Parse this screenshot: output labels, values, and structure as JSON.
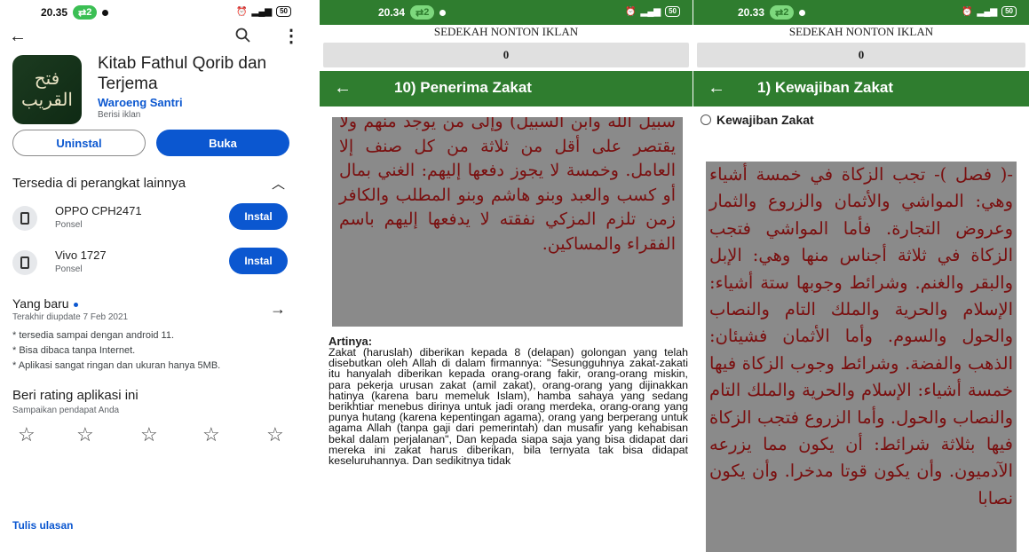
{
  "p1": {
    "status": {
      "time": "20.35",
      "badge": "2",
      "battery": "50"
    },
    "app": {
      "title": "Kitab Fathul Qorib dan Terjema",
      "developer": "Waroeng Santri",
      "ads": "Berisi iklan",
      "icon_text": "فتح القريب"
    },
    "buttons": {
      "uninstall": "Uninstal",
      "open": "Buka"
    },
    "other_devices": {
      "title": "Tersedia di perangkat lainnya",
      "devices": [
        {
          "name": "OPPO CPH2471",
          "type": "Ponsel",
          "action": "Instal"
        },
        {
          "name": "Vivo 1727",
          "type": "Ponsel",
          "action": "Instal"
        }
      ]
    },
    "whats_new": {
      "title": "Yang baru",
      "updated": "Terakhir diupdate 7 Feb 2021",
      "notes": [
        "* tersedia sampai dengan android 11.",
        "* Bisa dibaca tanpa Internet.",
        "* Aplikasi sangat ringan dan ukuran hanya 5MB."
      ]
    },
    "rating": {
      "title": "Beri rating aplikasi ini",
      "subtitle": "Sampaikan pendapat Anda"
    },
    "write_review": "Tulis ulasan"
  },
  "p2": {
    "status": {
      "time": "20.34",
      "badge": "2",
      "battery": "50"
    },
    "banner": "SEDEKAH NONTON IKLAN",
    "counter": "0",
    "title": "10) Penerima Zakat",
    "arabic": "سبيل الله وابن السبيل) وإلى من يوجد منهم ولا يقتصر على أقل من ثلاثة من كل صنف إلا العامل. وخمسة لا يجوز دفعها إليهم: الغني بمال أو كسب والعبد وبنو هاشم وبنو المطلب والكافر زمن تلزم المزكي نفقته لا يدفعها إليهم باسم الفقراء والمساكين.",
    "artinya_label": "Artinya:",
    "artinya": "Zakat (haruslah) diberikan kepada 8 (delapan) golongan yang telah disebutkan oleh Allah di dalam firmannya: \"Sesungguhnya zakat-zakati itu hanyalah diberikan kepada orang-orang fakir, orang-orang miskin, para pekerja urusan zakat (amil zakat), orang-orang yang dijinakkan hatinya (karena baru memeluk Islam), hamba sahaya yang sedang berikhtiar menebus dirinya untuk jadi orang merdeka, orang-orang yang punya hutang (karena kepentingan agama), orang yang berperang untuk agama Allah (tanpa gaji dari pemerintah) dan musafir yang kehabisan bekal dalam perjalanan\", Dan kepada siapa saja yang bisa didapat dari mereka ini zakat harus diberikan, bila ternyata tak bisa didapat keseluruhannya. Dan sedikitnya tidak"
  },
  "p3": {
    "status": {
      "time": "20.33",
      "badge": "2",
      "battery": "50"
    },
    "banner": "SEDEKAH NONTON IKLAN",
    "counter": "0",
    "title": "1) Kewajiban Zakat",
    "subtitle": "Kewajiban Zakat",
    "arabic": "-( فصل )- تجب الزكاة في خمسة أشياء وهي: المواشي والأثمان والزروع والثمار وعروض التجارة. فأما المواشي فتجب الزكاة في ثلاثة أجناس منها وهي: الإبل والبقر والغنم. وشرائط وجوبها ستة أشياء: الإسلام والحرية والملك التام والنصاب والحول والسوم. وأما الأثمان فشيئان: الذهب والفضة. وشرائط وجوب الزكاة فيها خمسة أشياء: الإسلام والحرية والملك التام والنصاب والحول. وأما الزروع فتجب الزكاة فيها بثلاثة شرائط: أن يكون مما يزرعه الآدميون. وأن يكون قوتا مدخرا. وأن يكون نصابا"
  }
}
